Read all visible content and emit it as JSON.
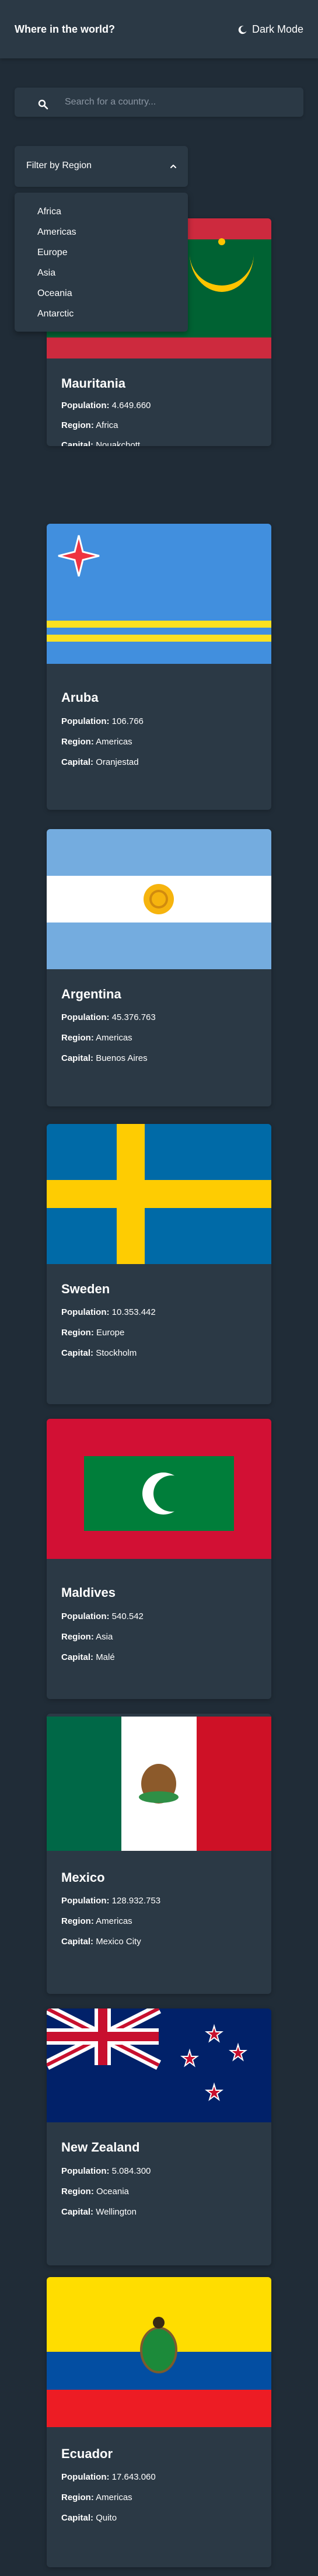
{
  "header": {
    "title": "Where in the world?",
    "mode_label": "Dark Mode"
  },
  "search": {
    "placeholder": "Search for a country..."
  },
  "filter": {
    "label": "Filter by Region",
    "options": [
      "Africa",
      "Americas",
      "Europe",
      "Asia",
      "Oceania",
      "Antarctic"
    ]
  },
  "field_labels": {
    "population": "Population:",
    "region": "Region:",
    "capital": "Capital:"
  },
  "countries": [
    {
      "name": "Mauritania",
      "population": "4.649.660",
      "region": "Africa",
      "capital": "Nouakchott"
    },
    {
      "name": "Aruba",
      "population": "106.766",
      "region": "Americas",
      "capital": "Oranjestad"
    },
    {
      "name": "Argentina",
      "population": "45.376.763",
      "region": "Americas",
      "capital": "Buenos Aires"
    },
    {
      "name": "Sweden",
      "population": "10.353.442",
      "region": "Europe",
      "capital": "Stockholm"
    },
    {
      "name": "Maldives",
      "population": "540.542",
      "region": "Asia",
      "capital": "Malé"
    },
    {
      "name": "Mexico",
      "population": "128.932.753",
      "region": "Americas",
      "capital": "Mexico City"
    },
    {
      "name": "New Zealand",
      "population": "5.084.300",
      "region": "Oceania",
      "capital": "Wellington"
    },
    {
      "name": "Ecuador",
      "population": "17.643.060",
      "region": "Americas",
      "capital": "Quito"
    }
  ],
  "colors": {
    "background": "#202c37",
    "element": "#2b3945",
    "text": "#ffffff"
  }
}
